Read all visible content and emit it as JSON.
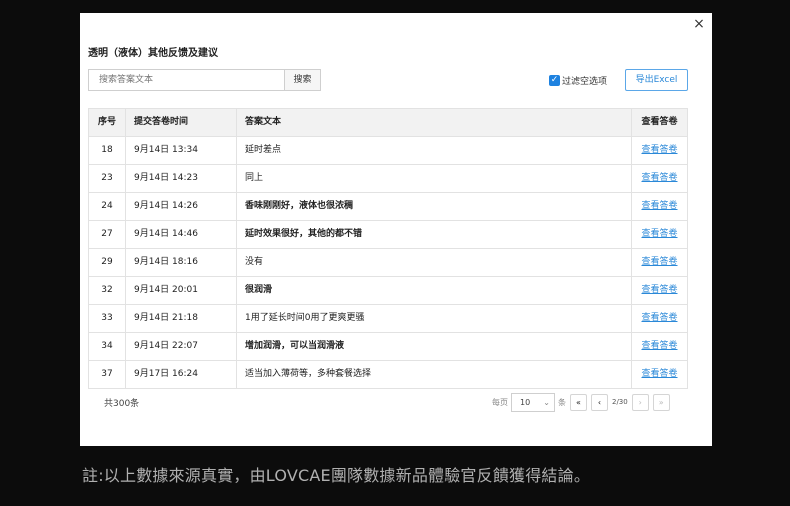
{
  "modal": {
    "title": "透明（液体）其他反馈及建议",
    "close_label": "×",
    "search": {
      "placeholder": "搜索答案文本",
      "value": "",
      "button_label": "搜索"
    },
    "filter": {
      "label": "过滤空选项",
      "checked": true
    },
    "export_label": "导出Excel"
  },
  "table": {
    "headers": [
      "序号",
      "提交答卷时间",
      "答案文本",
      "查看答卷"
    ],
    "rows": [
      {
        "id": "18",
        "time": "9月14日 13:34",
        "answer": "延时差点",
        "link": "查看答卷",
        "bold": false
      },
      {
        "id": "23",
        "time": "9月14日 14:23",
        "answer": "同上",
        "link": "查看答卷",
        "bold": false
      },
      {
        "id": "24",
        "time": "9月14日 14:26",
        "answer": "香味刚刚好，液体也很浓稠",
        "link": "查看答卷",
        "bold": true
      },
      {
        "id": "27",
        "time": "9月14日 14:46",
        "answer": "延时效果很好，其他的都不错",
        "link": "查看答卷",
        "bold": true
      },
      {
        "id": "29",
        "time": "9月14日 18:16",
        "answer": "没有",
        "link": "查看答卷",
        "bold": false
      },
      {
        "id": "32",
        "time": "9月14日 20:01",
        "answer": "很润滑",
        "link": "查看答卷",
        "bold": true
      },
      {
        "id": "33",
        "time": "9月14日 21:18",
        "answer": "1用了延长时间0用了更爽更骚",
        "link": "查看答卷",
        "bold": false
      },
      {
        "id": "34",
        "time": "9月14日 22:07",
        "answer": "增加润滑，可以当润滑液",
        "link": "查看答卷",
        "bold": true
      },
      {
        "id": "37",
        "time": "9月17日 16:24",
        "answer": "适当加入薄荷等，多种套餐选择",
        "link": "查看答卷",
        "bold": false
      }
    ]
  },
  "pagination": {
    "total": "共300条",
    "per_page_label": "每页",
    "per_page_value": "10",
    "unit_label": "条",
    "first_icon": "«",
    "prev_icon": "‹",
    "page_info": "2/30",
    "next_icon": "›",
    "last_icon": "»"
  },
  "footer": "註:以上數據來源真實，由LOVCAE團隊數據新品體驗官反饋獲得結論。",
  "colors": {
    "accent": "#2a88d8",
    "backdrop": "#0c0c0c"
  }
}
